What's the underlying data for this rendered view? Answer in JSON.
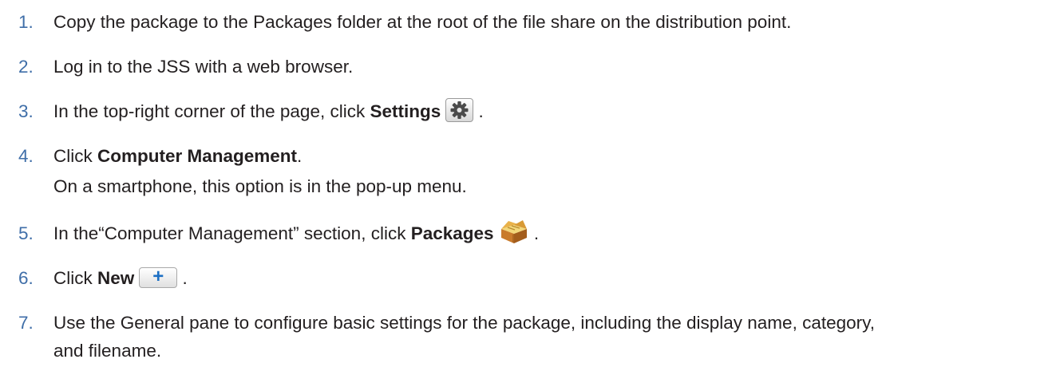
{
  "steps": [
    {
      "num": "1.",
      "text": "Copy the package to the Packages folder at the root of the file share on the distribution point."
    },
    {
      "num": "2.",
      "text": "Log in to the JSS with a web browser."
    },
    {
      "num": "3.",
      "pre": "In the top-right corner of the page, click ",
      "bold": "Settings",
      "post": "."
    },
    {
      "num": "4.",
      "pre": "Click ",
      "bold": "Computer Management",
      "post": ".",
      "note": "On a smartphone, this option is in the pop-up menu."
    },
    {
      "num": "5.",
      "pre": "In the“Computer Management” section, click ",
      "bold": "Packages",
      "post": "."
    },
    {
      "num": "6.",
      "pre": "Click ",
      "bold": "New",
      "post": "."
    },
    {
      "num": "7.",
      "line1": "Use the General pane to configure basic settings for the package, including the display name, category,",
      "line2": "and filename."
    }
  ],
  "icons": {
    "settings": "gear-icon",
    "packages": "package-box-icon",
    "new": "plus-icon",
    "new_glyph": "+"
  },
  "colors": {
    "step_number": "#3f6ea8",
    "body_text": "#231f20",
    "plus": "#1b6fc4"
  }
}
